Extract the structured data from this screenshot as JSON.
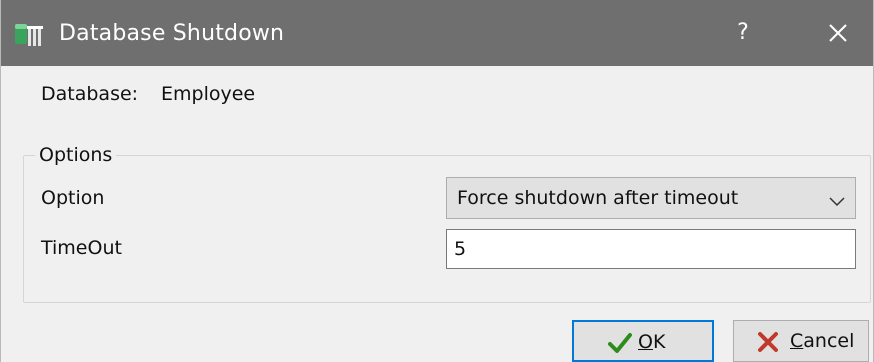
{
  "window": {
    "title": "Database Shutdown",
    "help_glyph": "?",
    "icons": {
      "app": "database-app-icon",
      "close": "close-icon"
    },
    "titlebar_color": "#6f6f6f"
  },
  "database": {
    "label": "Database:",
    "value": "Employee"
  },
  "options_group": {
    "legend": "Options",
    "option": {
      "label": "Option",
      "selected": "Force shutdown after timeout",
      "icon": "chevron-down-icon"
    },
    "timeout": {
      "label": "TimeOut",
      "value": "5"
    }
  },
  "buttons": {
    "ok": {
      "mnemonic": "O",
      "rest": "K",
      "icon": "checkmark-icon",
      "icon_color": "#2e8b1e",
      "focus_color": "#0078d7"
    },
    "cancel": {
      "mnemonic": "C",
      "rest": "ancel",
      "icon": "red-x-icon",
      "icon_color": "#c0392b"
    }
  }
}
